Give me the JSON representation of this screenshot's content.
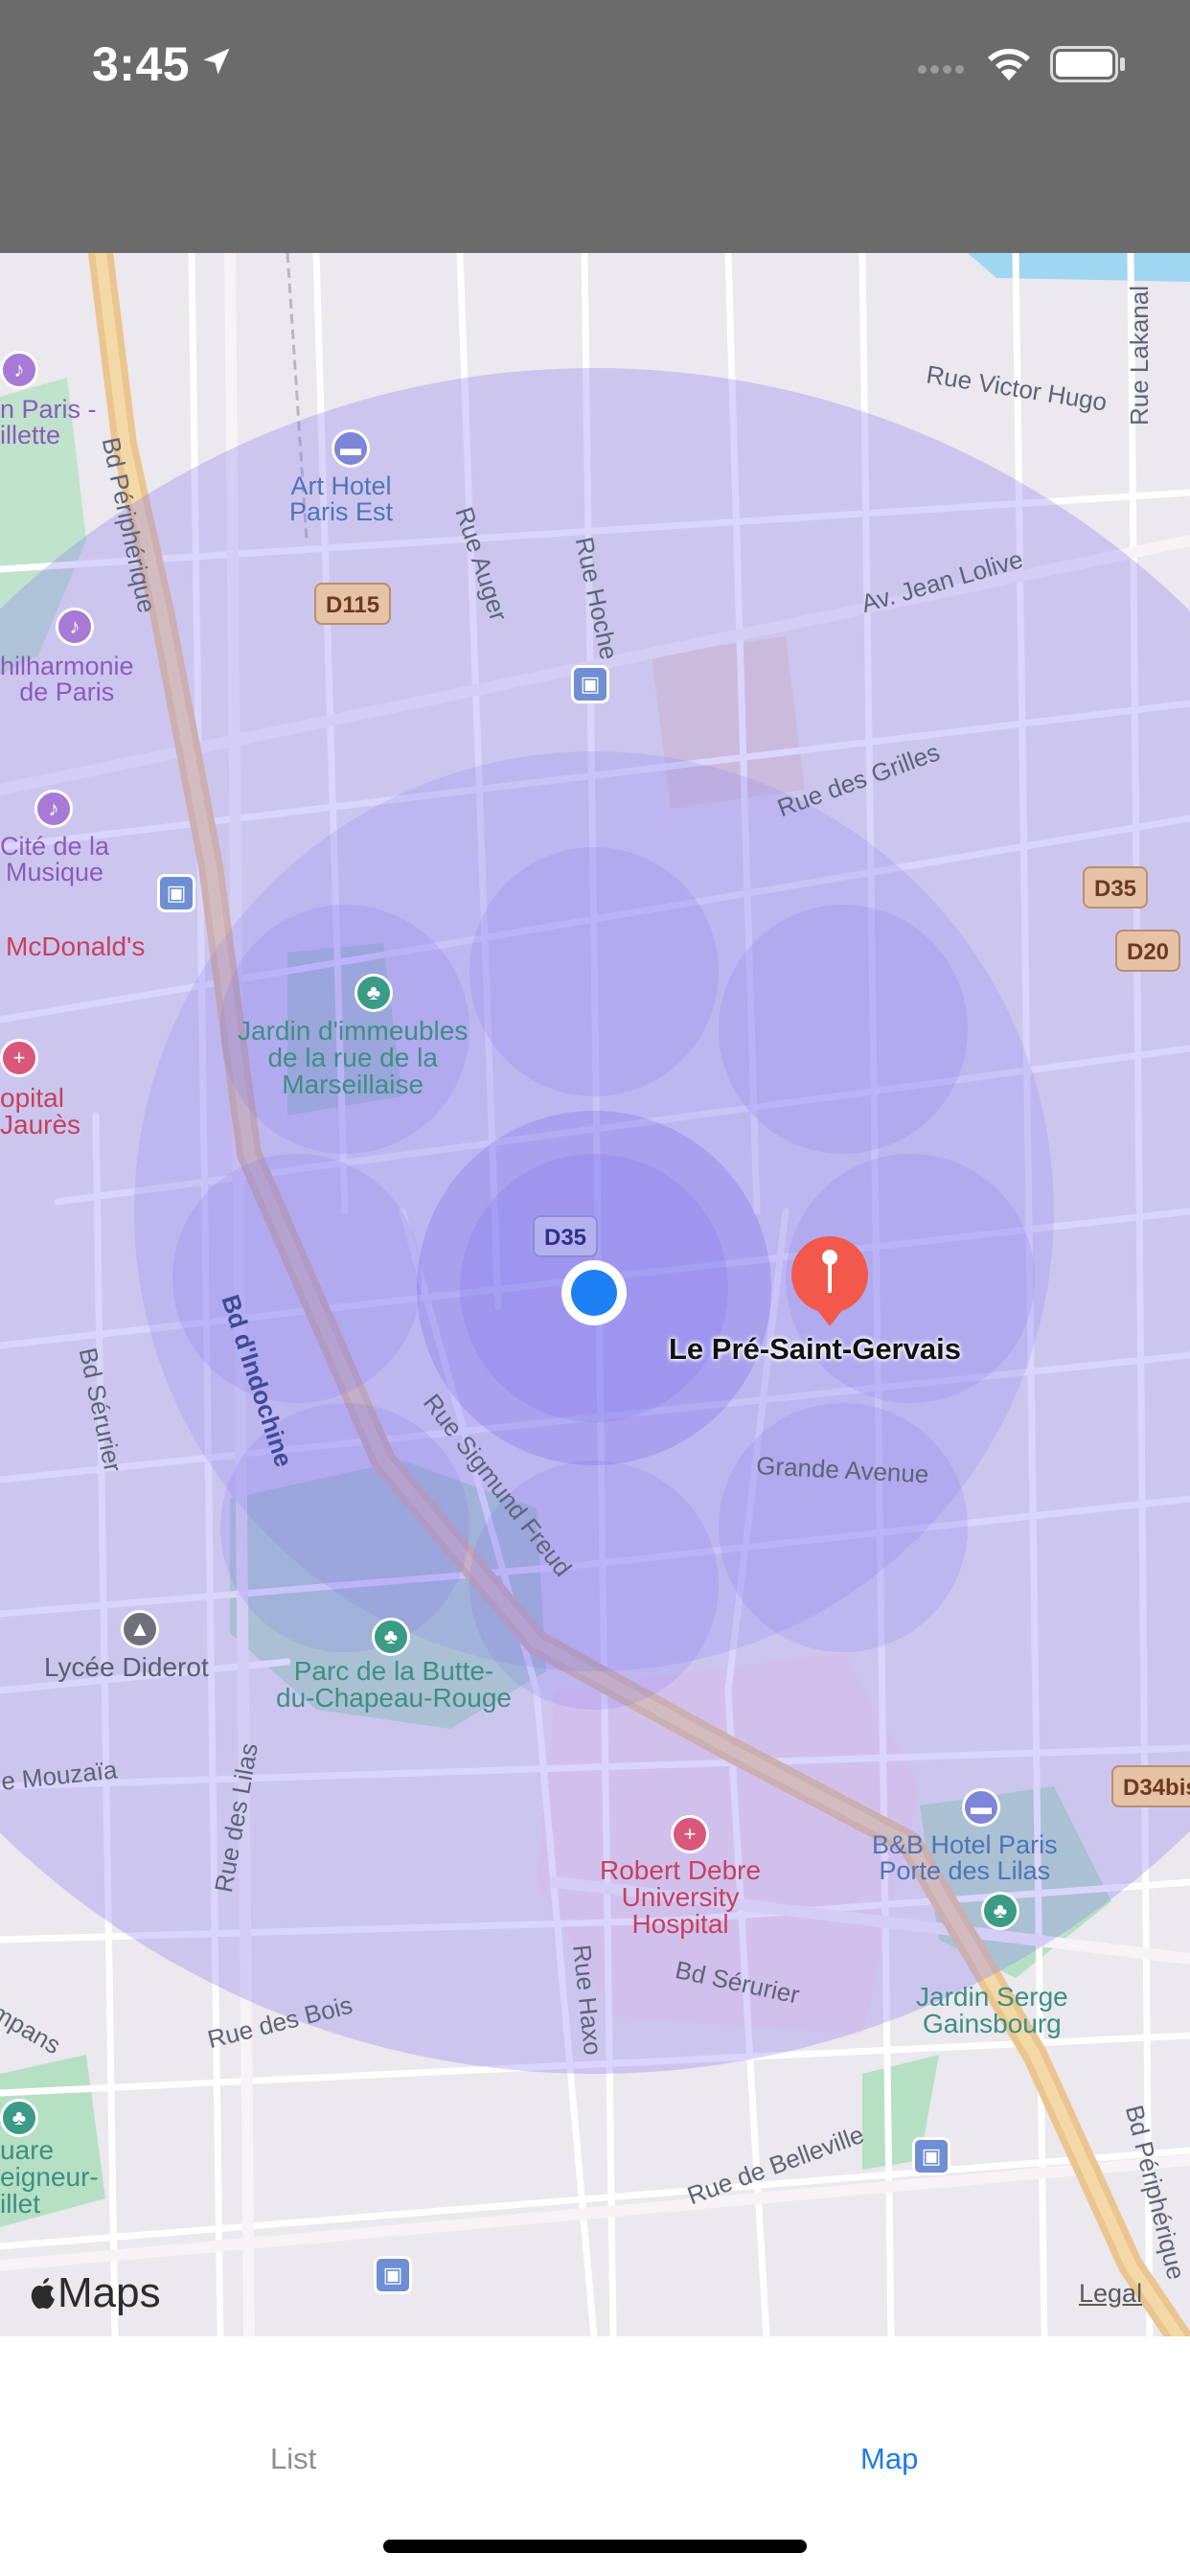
{
  "status_bar": {
    "time": "3:45"
  },
  "map": {
    "place_name": "Le Pré-Saint-Gervais",
    "brand": "Maps",
    "legal": "Legal",
    "streets": [
      "Rue Victor Hugo",
      "Rue Lakanal",
      "Bd Périphérique",
      "Rue Auger",
      "Rue Hoche",
      "Av. Jean Lolive",
      "Rue des Grilles",
      "Bd d'Indochine",
      "Bd Sérurier",
      "Rue Sigmund Freud",
      "Grande Avenue",
      "Rue des Lilas",
      "Rue des Bois",
      "Rue Haxo",
      "Bd Sérurier",
      "Rue de Belleville",
      "Bd Périphérique",
      "e Mouzaïa",
      "mpans"
    ],
    "shields": [
      "D115",
      "D35",
      "D20",
      "D35",
      "D34bis"
    ],
    "pois": {
      "art_hotel": "Art Hotel\nParis Est",
      "paris_villette": "n Paris -\nillette",
      "philharmonie": "hilharmonie\nde Paris",
      "cite_musique": "Cité de la\nMusique",
      "mcdonalds": "McDonald's",
      "hopital_jaures": "opital\nJaurès",
      "jardin_immeubles": "Jardin d'immeubles\nde la rue de la\nMarseillaise",
      "lycee_diderot": "Lycée Diderot",
      "parc_butte": "Parc de la Butte-\ndu-Chapeau-Rouge",
      "robert_debre": "Robert Debre\nUniversity\nHospital",
      "bb_hotel": "B&B Hotel Paris\nPorte des Lilas",
      "jardin_serge": "Jardin Serge\nGainsbourg",
      "square_seigneur": "uare\neigneur-\nillet"
    }
  },
  "tabs": [
    {
      "label": "List",
      "selected": false
    },
    {
      "label": "Map",
      "selected": true
    }
  ],
  "colors": {
    "accent": "#1f7ae6",
    "pin": "#f2594b",
    "user_dot": "#1d80f4",
    "region_fill": "#8f83f3"
  }
}
